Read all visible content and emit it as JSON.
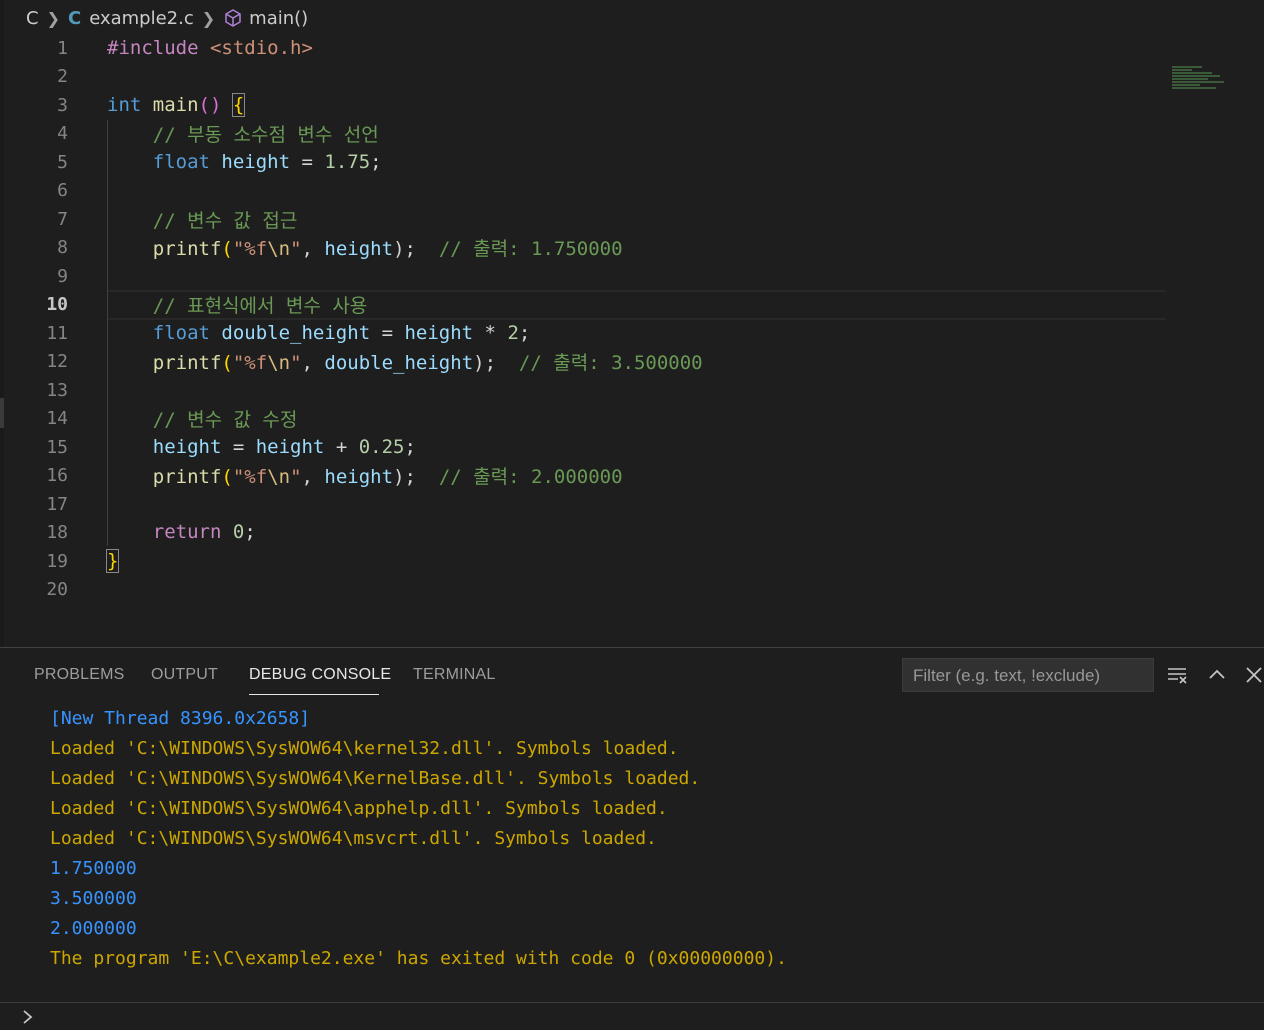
{
  "breadcrumb": {
    "folder": "C",
    "file": "example2.c",
    "file_icon_letter": "C",
    "symbol": "main()"
  },
  "editor": {
    "active_line": 10,
    "line_numbers": [
      "1",
      "2",
      "3",
      "4",
      "5",
      "6",
      "7",
      "8",
      "9",
      "10",
      "11",
      "12",
      "13",
      "14",
      "15",
      "16",
      "17",
      "18",
      "19",
      "20"
    ],
    "code": {
      "l1_directive": "#include",
      "l1_header": "<stdio.h>",
      "l3_type": "int",
      "l3_func": "main",
      "l3_parens": "()",
      "l3_brace": "{",
      "l4_comment": "// 부동 소수점 변수 선언",
      "l5_type": "float",
      "l5_var": "height",
      "l5_op": " = ",
      "l5_num": "1.75",
      "l5_end": ";",
      "l7_comment": "// 변수 값 접근",
      "l8_func": "printf",
      "l8_open": "(",
      "l8_str1": "\"%f",
      "l8_esc": "\\n",
      "l8_str2": "\"",
      "l8_comma": ", ",
      "l8_var": "height",
      "l8_close": ");",
      "l8_comment": "// 출력: 1.750000",
      "l10_comment": "// 표현식에서 변수 사용",
      "l11_type": "float",
      "l11_var": "double_height",
      "l11_op": " = ",
      "l11_var2": "height",
      "l11_op2": " * ",
      "l11_num": "2",
      "l11_end": ";",
      "l12_func": "printf",
      "l12_open": "(",
      "l12_str1": "\"%f",
      "l12_esc": "\\n",
      "l12_str2": "\"",
      "l12_comma": ", ",
      "l12_var": "double_height",
      "l12_close": ");",
      "l12_comment": "// 출력: 3.500000",
      "l14_comment": "// 변수 값 수정",
      "l15_var": "height",
      "l15_op": " = ",
      "l15_var2": "height",
      "l15_op2": " + ",
      "l15_num": "0.25",
      "l15_end": ";",
      "l16_func": "printf",
      "l16_open": "(",
      "l16_str1": "\"%f",
      "l16_esc": "\\n",
      "l16_str2": "\"",
      "l16_comma": ", ",
      "l16_var": "height",
      "l16_close": ");",
      "l16_comment": "// 출력: 2.000000",
      "l18_kw": "return",
      "l18_num": "0",
      "l18_end": ";",
      "l19_brace": "}"
    }
  },
  "panel": {
    "tabs": [
      "PROBLEMS",
      "OUTPUT",
      "DEBUG CONSOLE",
      "TERMINAL"
    ],
    "active_tab": "DEBUG CONSOLE",
    "filter_placeholder": "Filter (e.g. text, !exclude)",
    "console_lines": [
      "[New Thread 8396.0x2658]",
      "Loaded 'C:\\WINDOWS\\SysWOW64\\kernel32.dll'. Symbols loaded.",
      "Loaded 'C:\\WINDOWS\\SysWOW64\\KernelBase.dll'. Symbols loaded.",
      "Loaded 'C:\\WINDOWS\\SysWOW64\\apphelp.dll'. Symbols loaded.",
      "Loaded 'C:\\WINDOWS\\SysWOW64\\msvcrt.dll'. Symbols loaded.",
      "1.750000",
      "3.500000",
      "2.000000",
      "The program 'E:\\C\\example2.exe' has exited with code 0 (0x00000000)."
    ],
    "icons": [
      "clear-console-icon",
      "chevron-up-icon",
      "close-icon",
      "prompt-chevron-icon"
    ]
  },
  "colors": {
    "background": "#1e1e1e",
    "keyword": "#569cd6",
    "comment": "#6a9955",
    "string": "#ce9178",
    "console_blue": "#3794ff",
    "console_yellow": "#cca700"
  }
}
